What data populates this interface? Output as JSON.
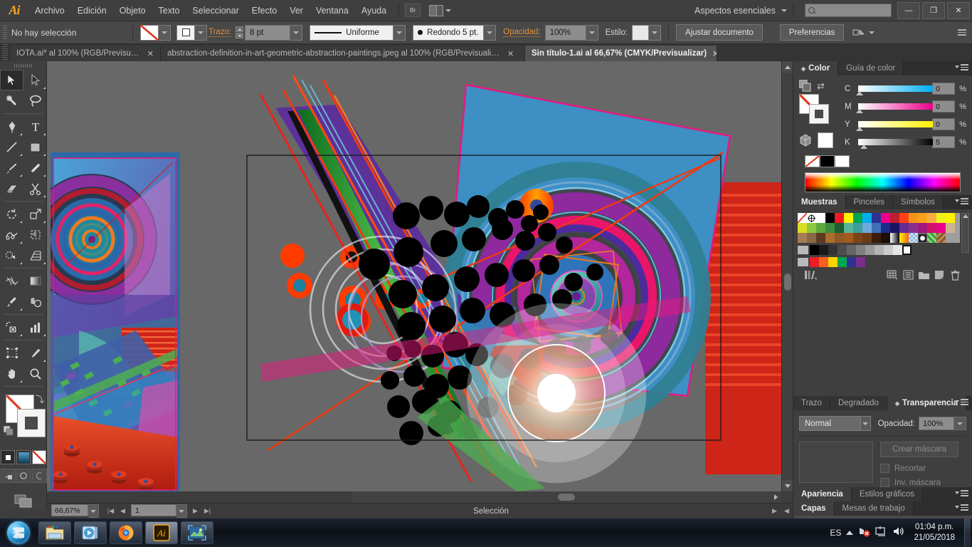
{
  "app": {
    "logo": "Ai",
    "menus": [
      "Archivo",
      "Edición",
      "Objeto",
      "Texto",
      "Seleccionar",
      "Efecto",
      "Ver",
      "Ventana",
      "Ayuda"
    ],
    "bridge_label": "Br",
    "workspace": "Aspectos esenciales",
    "search_placeholder": "",
    "window_buttons": {
      "minimize": "—",
      "restore": "❐",
      "close": "✕"
    }
  },
  "control_bar": {
    "selection_status": "No hay selección",
    "stroke_label": "Trazo:",
    "stroke_width": "8 pt",
    "stroke_profile": "Uniforme",
    "brush": "Redondo 5 pt.",
    "opacity_label": "Opacidad:",
    "opacity_value": "100%",
    "style_label": "Estilo:",
    "fit_document": "Ajustar documento",
    "preferences": "Preferencias"
  },
  "tabs": [
    {
      "title": "IOTA.ai* al 100% (RGB/Previsualiz...",
      "active": false,
      "close": "✕"
    },
    {
      "title": "abstraction-definition-in-art-geometric-abstraction-paintings.jpeg al 100% (RGB/Previsualiz...",
      "active": false,
      "close": "✕"
    },
    {
      "title": "Sin título-1.ai al 66,67% (CMYK/Previsualizar)",
      "active": true,
      "close": "✕"
    }
  ],
  "toolbox": {
    "tools": [
      "selection-tool",
      "direct-selection-tool",
      "magic-wand-tool",
      "lasso-tool",
      "pen-tool",
      "type-tool",
      "line-segment-tool",
      "rectangle-tool",
      "paintbrush-tool",
      "pencil-tool",
      "blob-brush-tool",
      "scissors-tool",
      "rotate-tool",
      "scale-tool",
      "width-tool",
      "free-transform-tool",
      "shape-builder-tool",
      "perspective-grid-tool",
      "mesh-tool",
      "gradient-tool",
      "eyedropper-tool",
      "blend-tool",
      "symbol-sprayer-tool",
      "column-graph-tool",
      "artboard-tool",
      "slice-tool",
      "hand-tool",
      "zoom-tool"
    ],
    "fill_stroke": {
      "fill": "none-white",
      "stroke": "gray-square",
      "swap": "swap-icon",
      "default": "default-icon"
    },
    "fill_modes": [
      "color-fill-mode",
      "gradient-fill-mode",
      "none-fill-mode"
    ],
    "draw_modes": [
      "draw-normal",
      "draw-behind",
      "draw-inside"
    ],
    "screen_mode": "change-screen-mode"
  },
  "panels": {
    "color": {
      "tabs": [
        "Color",
        "Guía de color"
      ],
      "active_tab": "Color",
      "channels": [
        {
          "key": "C",
          "value": "0",
          "unit": "%",
          "pos": 2
        },
        {
          "key": "M",
          "value": "0",
          "unit": "%",
          "pos": 2
        },
        {
          "key": "Y",
          "value": "0",
          "unit": "%",
          "pos": 2
        },
        {
          "key": "K",
          "value": "5",
          "unit": "%",
          "pos": 7
        }
      ]
    },
    "swatches": {
      "tabs": [
        "Muestras",
        "Pinceles",
        "Símbolos"
      ],
      "active_tab": "Muestras",
      "row1": [
        "#ffffff",
        "#ffffff",
        "#ffffff",
        "#000000",
        "#ed1c24",
        "#fff200",
        "#00a651",
        "#00aeef",
        "#2e3192",
        "#ec008c",
        "#be1e2d",
        "#ff4013",
        "#f7941e",
        "#f9a11b",
        "#fbb040",
        "#fff200"
      ],
      "row2": [
        "#d7df23",
        "#8dc63f",
        "#5ea93e",
        "#3d8c40",
        "#1f5c2e",
        "#56b49a",
        "#3c9f9c",
        "#6fa8dc",
        "#3f6fb5",
        "#1b2c8a",
        "#1b1464",
        "#662d91",
        "#8b2f8f",
        "#a1167f",
        "#d0136a",
        "#ec008c"
      ],
      "row3": [
        "#cdb393",
        "#a67c52",
        "#8a6746",
        "#5c3a21",
        "#a9702c",
        "#8f5a28",
        "#a35a1e",
        "#7a4418",
        "#6b3a12",
        "#3a1d08",
        "#1a0d04",
        "#ffffff",
        "#f7941e",
        "#7fb8e8",
        "#ffffff",
        "#3aa33a"
      ],
      "gray_row": [
        "#000000",
        "#1a1a1a",
        "#333333",
        "#4d4d4d",
        "#666666",
        "#808080",
        "#999999",
        "#b3b3b3",
        "#cccccc",
        "#e6e6e6",
        "#ffffff"
      ],
      "color_row": [
        "#ed1c24",
        "#f7601e",
        "#ffd400",
        "#00a651",
        "#2e3192",
        "#7b2d8e"
      ]
    },
    "transparency": {
      "tabs": [
        "Trazo",
        "Degradado",
        "Transparencia"
      ],
      "active_tab": "Transparencia",
      "blend_mode": "Normal",
      "opacity_label": "Opacidad:",
      "opacity_value": "100%",
      "make_mask": "Crear máscara",
      "clip": "Recortar",
      "invert_mask": "Inv. máscara"
    },
    "appearance": {
      "tabs": [
        "Apariencia",
        "Estilos gráficos"
      ],
      "active_tab": "Apariencia"
    },
    "layers": {
      "tabs": [
        "Capas",
        "Mesas de trabajo"
      ],
      "active_tab": "Capas"
    }
  },
  "status_bar": {
    "zoom": "66,67%",
    "page": "1",
    "tool_status": "Selección"
  },
  "taskbar": {
    "start": "start-orb",
    "apps": [
      "windows-explorer",
      "windows-media-player",
      "mozilla-firefox",
      "adobe-illustrator",
      "windows-photo-viewer"
    ],
    "language": "ES",
    "tray_icons": [
      "network-error-icon",
      "action-center-icon",
      "volume-icon"
    ],
    "time": "01:04 p.m.",
    "date": "21/05/2018"
  },
  "artwork": {
    "title": "abstract-geometric-composition",
    "description": "Abstract vector composition with concentric rings, black dots grid, diagonal stripes and translucent circles"
  }
}
